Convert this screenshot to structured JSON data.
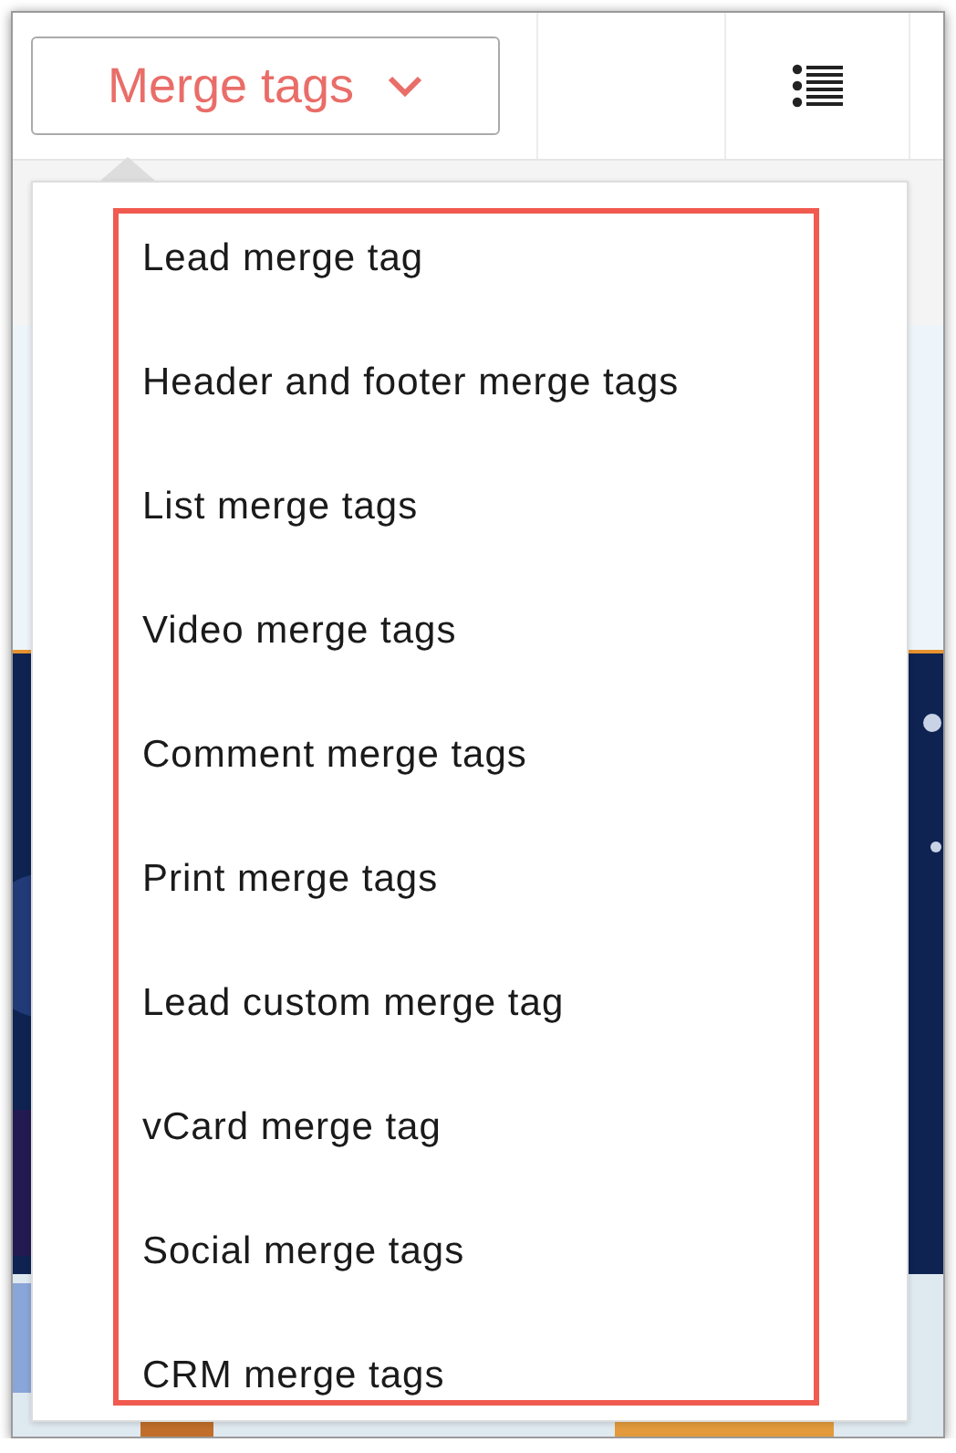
{
  "toolbar": {
    "merge_button": {
      "label": "Merge tags",
      "expanded": true
    }
  },
  "menu": {
    "highlighted": true,
    "items": [
      {
        "label": "Lead merge tag"
      },
      {
        "label": "Header and footer merge tags"
      },
      {
        "label": "List merge tags"
      },
      {
        "label": "Video merge tags"
      },
      {
        "label": "Comment merge tags"
      },
      {
        "label": "Print merge tags"
      },
      {
        "label": "Lead custom merge tag"
      },
      {
        "label": "vCard merge tag"
      },
      {
        "label": "Social merge tags"
      },
      {
        "label": "CRM merge tags"
      }
    ]
  }
}
